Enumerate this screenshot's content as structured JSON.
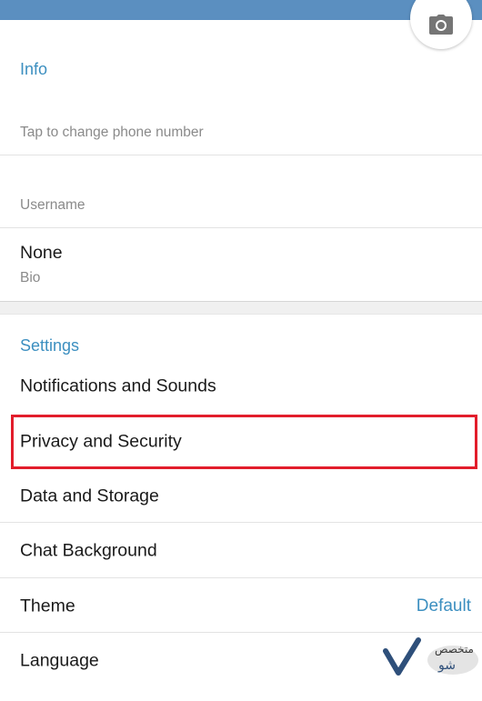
{
  "header": {
    "camera_icon": "camera-icon"
  },
  "info": {
    "title": "Info",
    "phone_hint": "Tap to change phone number",
    "username_label": "Username",
    "bio_value": "None",
    "bio_label": "Bio"
  },
  "settings": {
    "title": "Settings",
    "items": [
      {
        "label": "Notifications and Sounds"
      },
      {
        "label": "Privacy and Security"
      },
      {
        "label": "Data and Storage"
      },
      {
        "label": "Chat Background"
      },
      {
        "label": "Theme",
        "value": "Default"
      },
      {
        "label": "Language"
      }
    ]
  },
  "colors": {
    "accent": "#3c8fc0",
    "topbar": "#5b8fc0",
    "highlight": "#e21d2b"
  }
}
